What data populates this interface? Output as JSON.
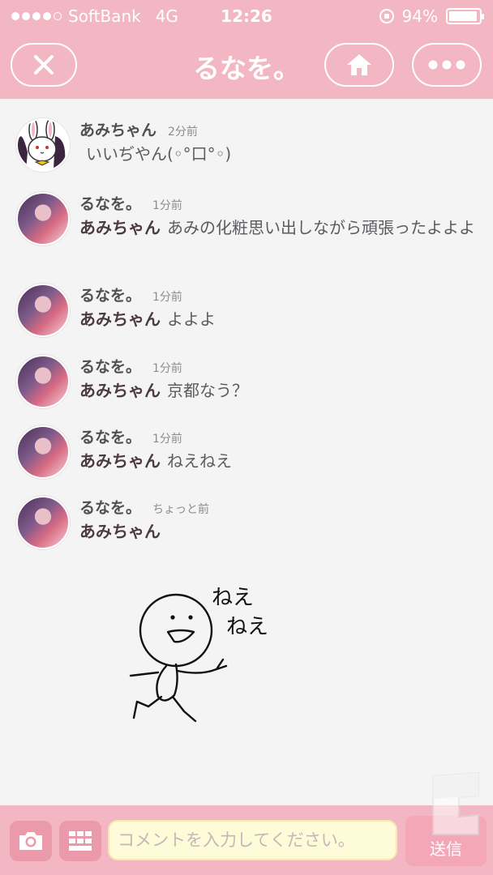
{
  "status_bar": {
    "carrier": "SoftBank",
    "network": "4G",
    "time": "12:26",
    "battery": "94%",
    "battery_level": 0.94
  },
  "header": {
    "title": "るなを。",
    "close_icon": "close-icon",
    "home_icon": "home-icon",
    "more_icon": "more-icon"
  },
  "messages": [
    {
      "sender": "あみちゃん",
      "time": "2分前",
      "mention": "",
      "text": "いいぢやん(◦°口°◦)"
    },
    {
      "sender": "るなを。",
      "time": "1分前",
      "mention": "あみちゃん",
      "text": "あみの化粧思い出しながら頑張ったよよよ"
    },
    {
      "sender": "るなを。",
      "time": "1分前",
      "mention": "あみちゃん",
      "text": "よよよ"
    },
    {
      "sender": "るなを。",
      "time": "1分前",
      "mention": "あみちゃん",
      "text": "京都なう？"
    },
    {
      "sender": "るなを。",
      "time": "1分前",
      "mention": "あみちゃん",
      "text": "ねえねえ"
    },
    {
      "sender": "るなを。",
      "time": "ちょっと前",
      "mention": "あみちゃん",
      "text": ""
    }
  ],
  "drawing": {
    "line1": "ねえ",
    "line2": "ねえ"
  },
  "composer": {
    "placeholder": "コメントを入力してください。",
    "value": "",
    "send_label": "送信",
    "camera_icon": "camera-icon",
    "keyboard_icon": "keyboard-icon"
  },
  "colors": {
    "bar_pink": "#f2b7c3",
    "button_pink": "#ea9aaa",
    "input_yellow": "#fefbd9",
    "background": "#f5f4f4"
  }
}
